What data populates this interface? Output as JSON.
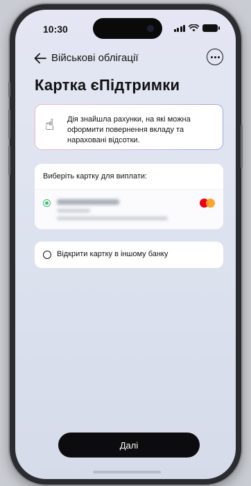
{
  "status_bar": {
    "time": "10:30"
  },
  "nav": {
    "title": "Військові облігації",
    "back_icon": "arrow-left-icon",
    "more_icon": "more-horizontal-icon"
  },
  "page_title": "Картка єПідтримки",
  "info_card": {
    "emoji": "☝",
    "text": "Дія знайшла рахунки, на які можна оформити повернення вкладу та нараховані відсотки."
  },
  "select_card": {
    "label": "Виберіть картку для виплати:",
    "selected_card": {
      "brand_icon": "mastercard-icon",
      "status": "selected"
    }
  },
  "other_bank": {
    "label": "Відкрити картку в іншому банку"
  },
  "footer": {
    "next_label": "Далі"
  },
  "colors": {
    "accent_green": "#3dbf6a",
    "primary_button": "#0c0c0e",
    "background": "#e0e4f0"
  }
}
